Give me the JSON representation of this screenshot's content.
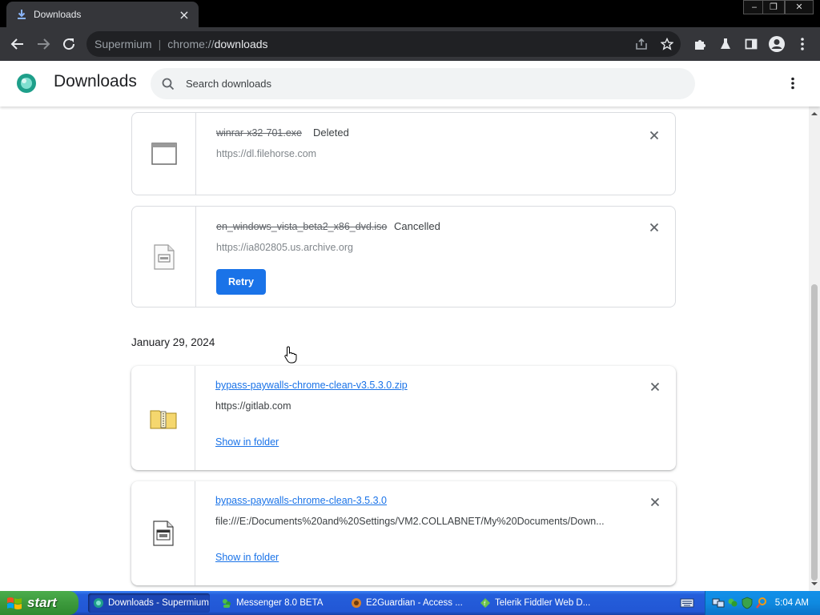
{
  "browser": {
    "tab_title": "Downloads",
    "omnibox": {
      "site_label": "Supermium",
      "scheme": "chrome://",
      "path": "downloads"
    }
  },
  "page": {
    "title": "Downloads",
    "search_placeholder": "Search downloads"
  },
  "downloads": [
    {
      "file_name": "winrar-x32-701.exe",
      "status": "Deleted",
      "url": "https://dl.filehorse.com"
    },
    {
      "file_name": "en_windows_vista_beta2_x86_dvd.iso",
      "status": "Cancelled",
      "url": "https://ia802805.us.archive.org",
      "action_label": "Retry"
    }
  ],
  "date_group": "January 29, 2024",
  "completed": [
    {
      "file_name": "bypass-paywalls-chrome-clean-v3.5.3.0.zip",
      "url": "https://gitlab.com",
      "action_label": "Show in folder"
    },
    {
      "file_name": "bypass-paywalls-chrome-clean-3.5.3.0",
      "url": "file:///E:/Documents%20and%20Settings/VM2.COLLABNET/My%20Documents/Down...",
      "action_label": "Show in folder"
    }
  ],
  "taskbar": {
    "start_label": "start",
    "tasks": [
      "Downloads - Supermium",
      "Messenger 8.0 BETA",
      "E2Guardian - Access ...",
      "Telerik Fiddler Web D..."
    ],
    "clock": "5:04 AM"
  },
  "colors": {
    "accent": "#1a73e8",
    "chrome_dark": "#35363a",
    "taskbar_blue": "#245edb",
    "start_green": "#3c9a3c"
  }
}
